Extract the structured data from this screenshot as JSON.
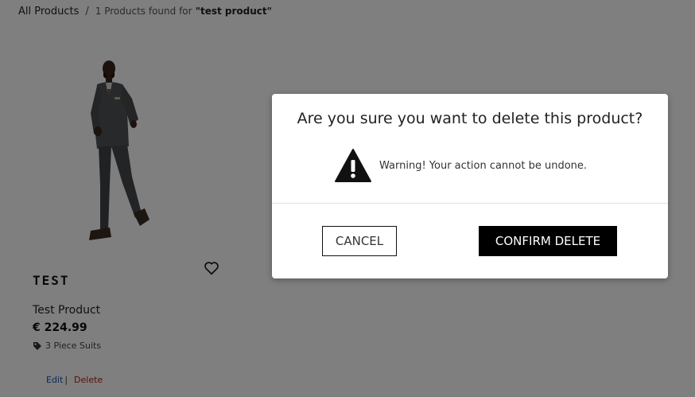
{
  "breadcrumb": {
    "all_products": "All Products",
    "separator": "/",
    "found_text": "1 Products found for",
    "query": "\"test product\""
  },
  "product": {
    "brand": "TEST",
    "name": "Test Product",
    "price": "€ 224.99",
    "category": "3 Piece Suits",
    "image": "man-in-grey-suit-photo"
  },
  "admin": {
    "edit_label": "Edit",
    "edit_separator": "|",
    "delete_label": "Delete"
  },
  "modal": {
    "title": "Are you sure you want to delete this product?",
    "warning": "Warning! Your action cannot be undone.",
    "cancel_label": "CANCEL",
    "confirm_label": "CONFIRM DELETE"
  },
  "icons": {
    "wishlist": "heart-outline-icon",
    "category": "tag-icon",
    "warning": "warning-triangle-icon"
  },
  "colors": {
    "overlay": "#7f7f7f",
    "edit_link": "#1f4fa8",
    "delete_link": "#b02020",
    "confirm_button": "#000000"
  }
}
